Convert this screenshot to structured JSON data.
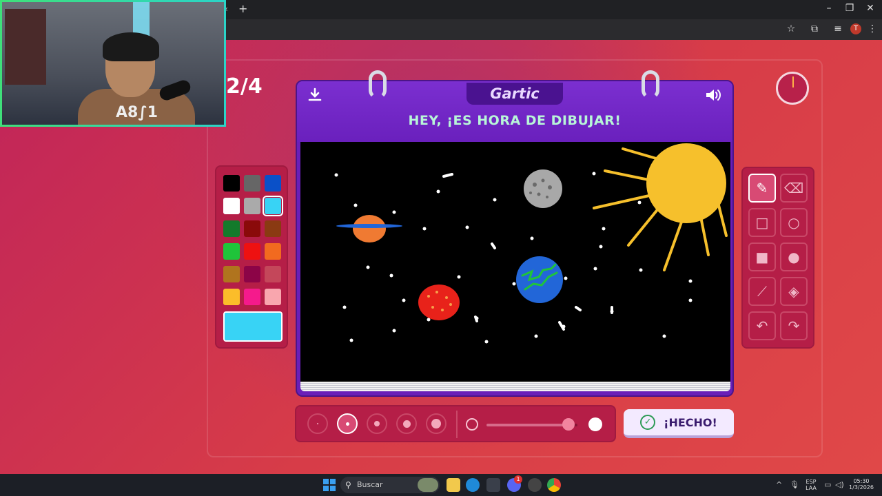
{
  "game": {
    "round": "2/4",
    "logo": "Gartic",
    "title": "HEY, ¡ES HORA DE DIBUJAR!",
    "done_label": "¡HECHO!",
    "selected_color": "#38d3f5"
  },
  "palette": [
    [
      "#000000",
      "#666666",
      "#0a50c8"
    ],
    [
      "#ffffff",
      "#aaaaaa",
      "#38d3f5"
    ],
    [
      "#137a2b",
      "#8a0a0a",
      "#8a3a12"
    ],
    [
      "#1fc43a",
      "#ee1111",
      "#f26a1f"
    ],
    [
      "#b0741e",
      "#8c0447",
      "#c4475a"
    ],
    [
      "#fbbd2a",
      "#f51a8c",
      "#f9a6ae"
    ]
  ],
  "tools": [
    {
      "name": "pencil-tool",
      "icon": "pencil-icon"
    },
    {
      "name": "eraser-tool",
      "icon": "eraser-icon"
    },
    {
      "name": "rectangle-tool",
      "icon": "square-outline-icon"
    },
    {
      "name": "ellipse-tool",
      "icon": "circle-outline-icon"
    },
    {
      "name": "filled-rectangle-tool",
      "icon": "square-filled-icon"
    },
    {
      "name": "filled-ellipse-tool",
      "icon": "circle-filled-icon"
    },
    {
      "name": "line-tool",
      "icon": "line-icon"
    },
    {
      "name": "fill-tool",
      "icon": "bucket-icon"
    },
    {
      "name": "undo-tool",
      "icon": "undo-icon"
    },
    {
      "name": "redo-tool",
      "icon": "redo-icon"
    }
  ],
  "brush": {
    "sizes": 5,
    "selected_size": 2,
    "opacity_level": 0.9
  },
  "taskbar": {
    "search_placeholder": "Buscar",
    "lang_top": "ESP",
    "lang_bottom": "LAA",
    "time": "05:30",
    "date": "1/3/2026",
    "discord_badge": "1"
  },
  "webcam": {
    "shirt_text": "A8∫1"
  },
  "profile_initial": "T"
}
